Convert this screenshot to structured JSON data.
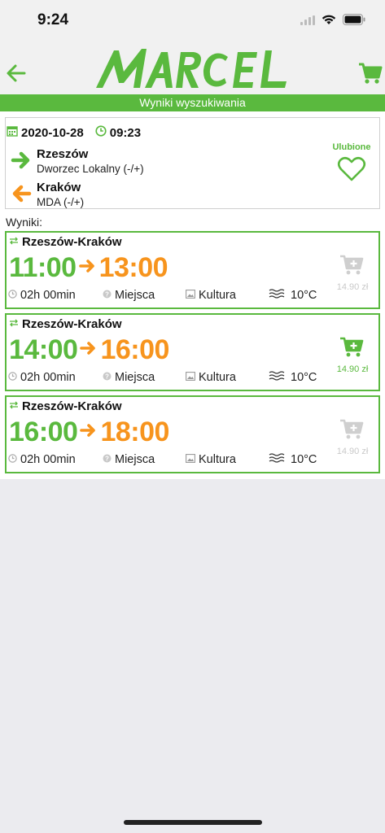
{
  "status": {
    "time": "9:24"
  },
  "header": {
    "logo_text": "MARCEL"
  },
  "subheader": {
    "title": "Wyniki wyszukiwania"
  },
  "search": {
    "date": "2020-10-28",
    "time": "09:23",
    "from": {
      "city": "Rzeszów",
      "stop": "Dworzec Lokalny (-/+)"
    },
    "to": {
      "city": "Kraków",
      "stop": "MDA (-/+)"
    },
    "favorite_label": "Ulubione"
  },
  "results_label": "Wyniki:",
  "results": [
    {
      "route": "Rzeszów-Kraków",
      "dep": "11:00",
      "arr": "13:00",
      "duration": "02h 00min",
      "seats": "Miejsca",
      "culture": "Kultura",
      "temp": "10°C",
      "price": "14.90 zł",
      "buyable": false
    },
    {
      "route": "Rzeszów-Kraków",
      "dep": "14:00",
      "arr": "16:00",
      "duration": "02h 00min",
      "seats": "Miejsca",
      "culture": "Kultura",
      "temp": "10°C",
      "price": "14.90 zł",
      "buyable": true
    },
    {
      "route": "Rzeszów-Kraków",
      "dep": "16:00",
      "arr": "18:00",
      "duration": "02h 00min",
      "seats": "Miejsca",
      "culture": "Kultura",
      "temp": "10°C",
      "price": "14.90 zł",
      "buyable": false
    }
  ],
  "colors": {
    "accent": "#5ab93e",
    "arrival": "#f7941d",
    "disabled": "#c9c9c9"
  },
  "icons": [
    "back-arrow-icon",
    "cart-icon",
    "calendar-icon",
    "clock-icon",
    "arrow-right-icon",
    "arrow-left-icon",
    "heart-icon",
    "swap-icon",
    "cart-plus-icon",
    "question-icon",
    "image-icon",
    "waves-icon"
  ]
}
